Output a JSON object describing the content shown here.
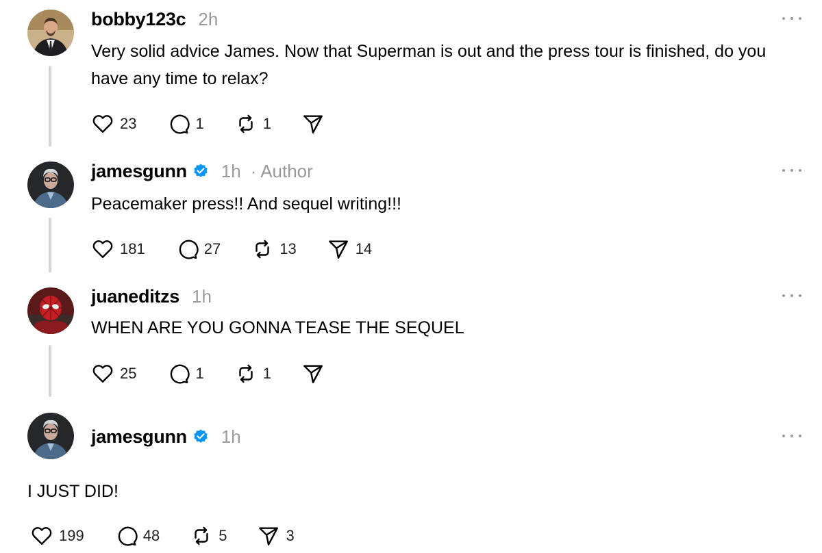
{
  "posts": [
    {
      "username": "bobby123c",
      "time": "2h",
      "author_tag": "",
      "verified": false,
      "text": "Very solid advice James. Now that Superman is out and the press tour is finished, do you have any time to relax?",
      "likes": "23",
      "replies": "1",
      "reposts": "1",
      "shares": ""
    },
    {
      "username": "jamesgunn",
      "time": "1h",
      "author_tag": "· Author",
      "verified": true,
      "text": "Peacemaker press!! And sequel writing!!!",
      "likes": "181",
      "replies": "27",
      "reposts": "13",
      "shares": "14"
    },
    {
      "username": "juaneditzs",
      "time": "1h",
      "author_tag": "",
      "verified": false,
      "text": "WHEN ARE YOU GONNA TEASE THE SEQUEL",
      "likes": "25",
      "replies": "1",
      "reposts": "1",
      "shares": ""
    },
    {
      "username": "jamesgunn",
      "time": "1h",
      "author_tag": "",
      "verified": true,
      "text": "I JUST DID!",
      "likes": "199",
      "replies": "48",
      "reposts": "5",
      "shares": "3"
    }
  ],
  "icons": {
    "like": "heart-icon",
    "reply": "comment-icon",
    "repost": "repost-icon",
    "share": "share-icon",
    "verified": "verified-badge-icon",
    "more": "more-options-icon"
  },
  "colors": {
    "verified": "#0095f6",
    "meta": "#9a9a9a",
    "thread_line": "#d6d6d6"
  }
}
